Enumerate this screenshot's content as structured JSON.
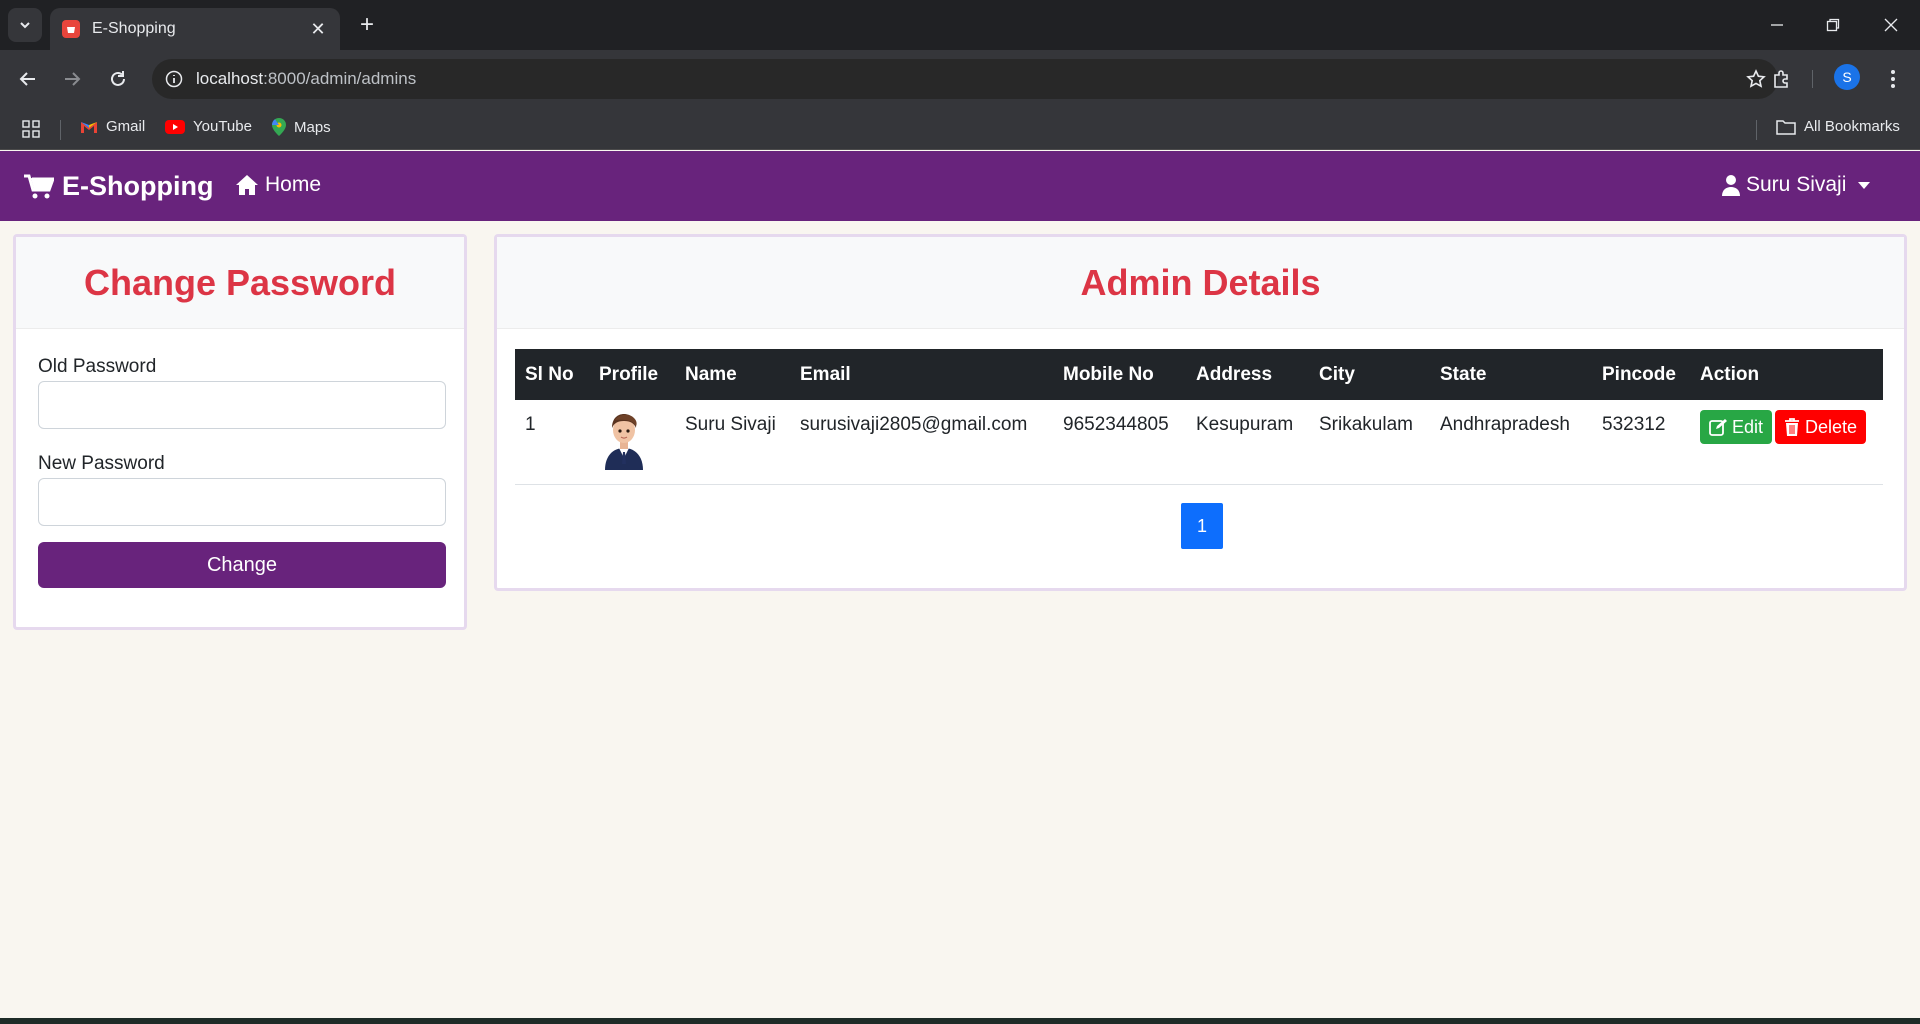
{
  "browser": {
    "tab_title": "E-Shopping",
    "url_host": "localhost",
    "url_path": ":8000/admin/admins",
    "profile_initial": "S",
    "bookmarks": [
      {
        "label": "Gmail",
        "icon": "gmail-icon"
      },
      {
        "label": "YouTube",
        "icon": "youtube-icon"
      },
      {
        "label": "Maps",
        "icon": "maps-icon"
      }
    ],
    "all_bookmarks_label": "All Bookmarks"
  },
  "navbar": {
    "brand": "E-Shopping",
    "home_label": "Home",
    "user_label": "Suru Sivaji",
    "color": "#68237c"
  },
  "change_password": {
    "title": "Change Password",
    "old_label": "Old Password",
    "old_value": "",
    "new_label": "New Password",
    "new_value": "",
    "button_label": "Change"
  },
  "admin_details": {
    "title": "Admin Details",
    "columns": [
      "Sl No",
      "Profile",
      "Name",
      "Email",
      "Mobile No",
      "Address",
      "City",
      "State",
      "Pincode",
      "Action"
    ],
    "rows": [
      {
        "sl_no": "1",
        "profile_icon": "profile-avatar-icon",
        "name": "Suru Sivaji",
        "email": "surusivaji2805@gmail.com",
        "mobile": "9652344805",
        "address": "Kesupuram",
        "city": "Srikakulam",
        "state": "Andhrapradesh",
        "pincode": "532312",
        "edit_label": "Edit",
        "delete_label": "Delete"
      }
    ],
    "pagination": {
      "current_page": "1"
    }
  },
  "colors": {
    "accent": "#68237c",
    "title_red": "#dc3545",
    "edit_green": "#28a745",
    "delete_red": "#ff0000",
    "page_blue": "#0d6efd"
  }
}
